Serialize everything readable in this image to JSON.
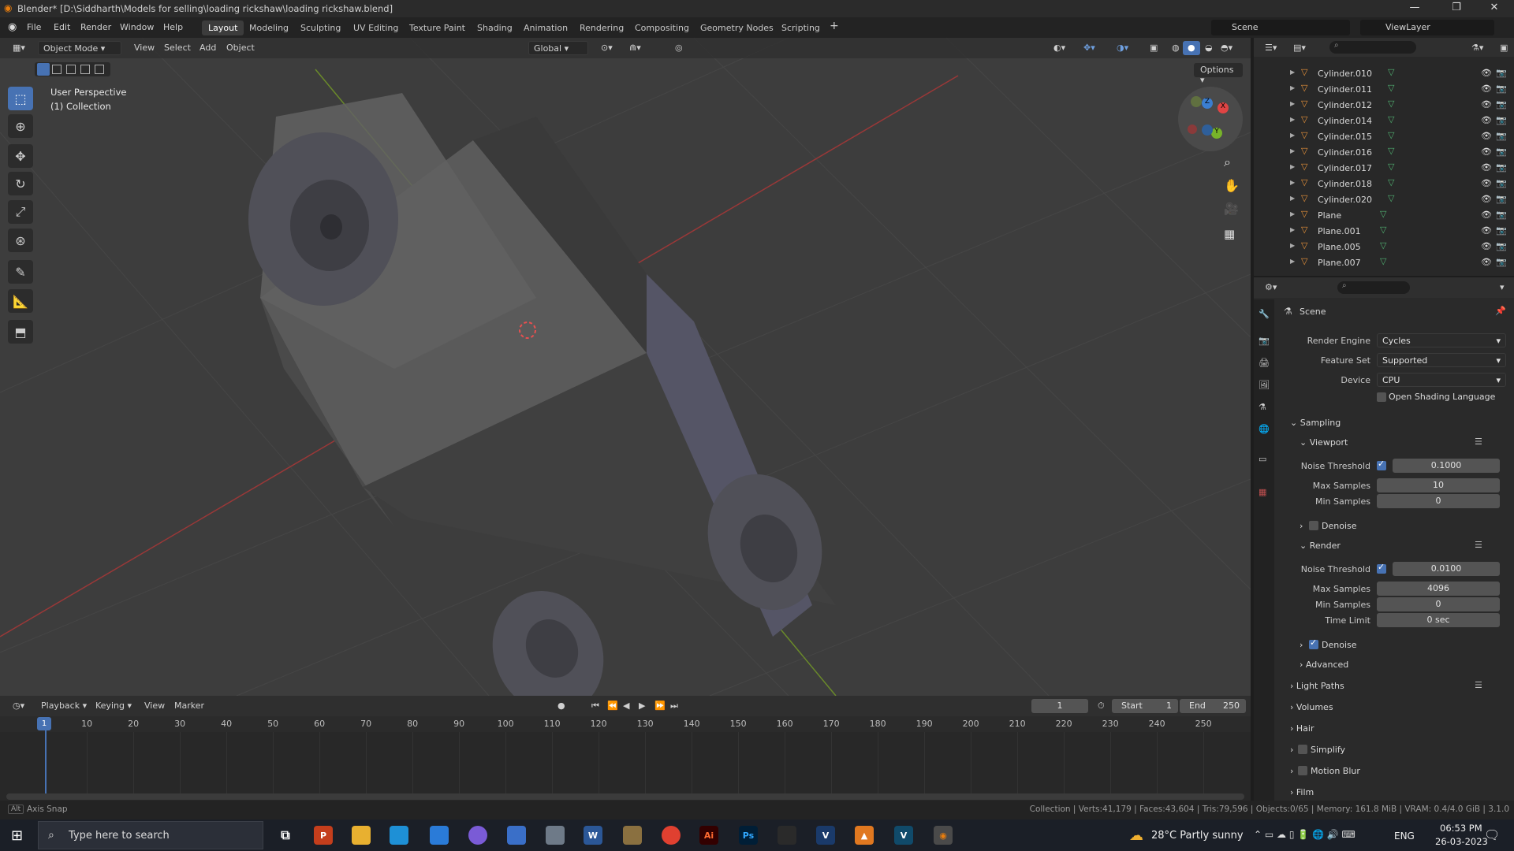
{
  "titlebar": {
    "title": "Blender* [D:\\Siddharth\\Models for selling\\loading rickshaw\\loading rickshaw.blend]"
  },
  "menu": {
    "items": [
      "File",
      "Edit",
      "Render",
      "Window",
      "Help"
    ]
  },
  "workspaces": {
    "tabs": [
      "Layout",
      "Modeling",
      "Sculpting",
      "UV Editing",
      "Texture Paint",
      "Shading",
      "Animation",
      "Rendering",
      "Compositing",
      "Geometry Nodes",
      "Scripting"
    ],
    "active": "Layout"
  },
  "scene": {
    "name": "Scene",
    "view_layer": "ViewLayer"
  },
  "viewport": {
    "mode": "Object Mode",
    "menus": [
      "View",
      "Select",
      "Add",
      "Object"
    ],
    "orientation": "Global",
    "options": "Options",
    "overlay_line1": "User Perspective",
    "overlay_line2": "(1) Collection",
    "gizmo_axes": {
      "x": "X",
      "y": "Y",
      "z": "Z"
    }
  },
  "outliner": {
    "items": [
      {
        "name": "Cylinder.010"
      },
      {
        "name": "Cylinder.011"
      },
      {
        "name": "Cylinder.012"
      },
      {
        "name": "Cylinder.014"
      },
      {
        "name": "Cylinder.015"
      },
      {
        "name": "Cylinder.016"
      },
      {
        "name": "Cylinder.017"
      },
      {
        "name": "Cylinder.018"
      },
      {
        "name": "Cylinder.020"
      },
      {
        "name": "Plane"
      },
      {
        "name": "Plane.001"
      },
      {
        "name": "Plane.005"
      },
      {
        "name": "Plane.007"
      }
    ]
  },
  "properties": {
    "context": "Scene",
    "render_engine_label": "Render Engine",
    "render_engine": "Cycles",
    "feature_set_label": "Feature Set",
    "feature_set": "Supported",
    "device_label": "Device",
    "device": "CPU",
    "osl_label": "Open Shading Language",
    "sampling": "Sampling",
    "viewport": "Viewport",
    "noise_threshold_label": "Noise Threshold",
    "max_samples_label": "Max Samples",
    "min_samples_label": "Min Samples",
    "time_limit_label": "Time Limit",
    "vp_noise_threshold": "0.1000",
    "vp_max_samples": "10",
    "vp_min_samples": "0",
    "denoise": "Denoise",
    "render": "Render",
    "r_noise_threshold": "0.0100",
    "r_max_samples": "4096",
    "r_min_samples": "0",
    "r_time_limit": "0 sec",
    "advanced": "Advanced",
    "light_paths": "Light Paths",
    "volumes": "Volumes",
    "hair": "Hair",
    "simplify": "Simplify",
    "motion_blur": "Motion Blur",
    "film": "Film"
  },
  "timeline": {
    "menus": [
      "Playback",
      "Keying",
      "View",
      "Marker"
    ],
    "current_frame": "1",
    "start_label": "Start",
    "start": "1",
    "end_label": "End",
    "end": "250",
    "ruler": [
      "10",
      "20",
      "30",
      "40",
      "50",
      "60",
      "70",
      "80",
      "90",
      "100",
      "110",
      "120",
      "130",
      "140",
      "150",
      "160",
      "170",
      "180",
      "190",
      "200",
      "210",
      "220",
      "230",
      "240",
      "250"
    ],
    "playhead": "1"
  },
  "status": {
    "left": "Axis Snap",
    "right": "Collection | Verts:41,179 | Faces:43,604 | Tris:79,596 | Objects:0/65 | Memory: 161.8 MiB | VRAM: 0.4/4.0 GiB | 3.1.0"
  },
  "taskbar": {
    "search_placeholder": "Type here to search",
    "weather": "28°C  Partly sunny",
    "lang": "ENG",
    "time": "06:53 PM",
    "date": "26-03-2023"
  }
}
